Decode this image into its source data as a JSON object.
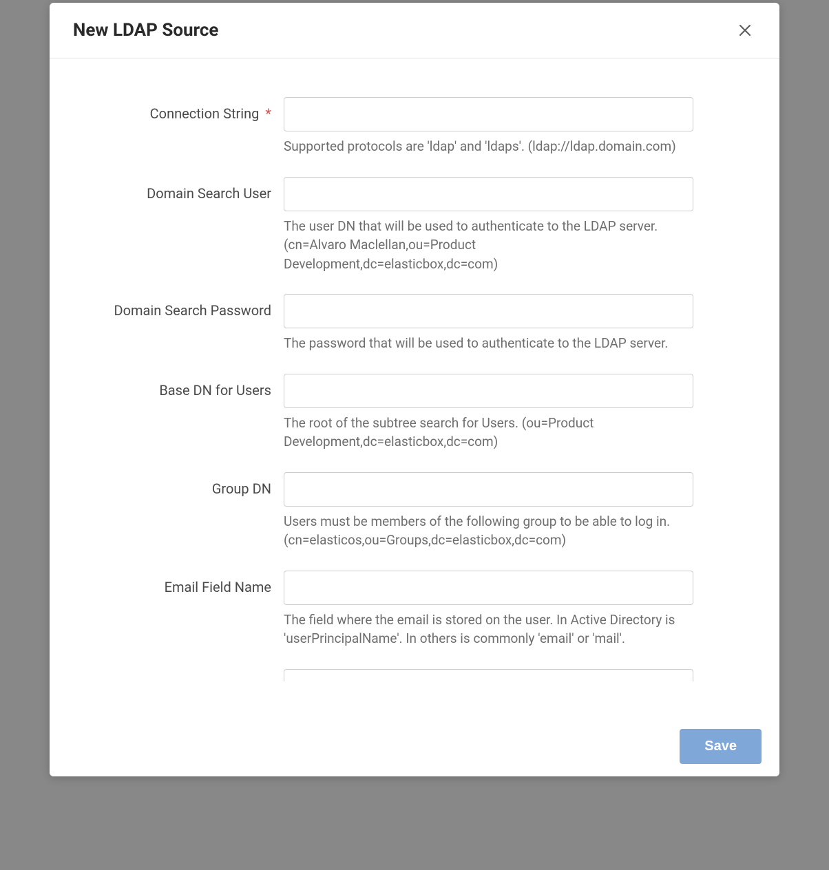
{
  "modal": {
    "title": "New LDAP Source",
    "close_label": "Close"
  },
  "form": {
    "fields": [
      {
        "label": "Connection String",
        "required": true,
        "value": "",
        "help": "Supported protocols are 'ldap' and 'ldaps'. (ldap://ldap.domain.com)"
      },
      {
        "label": "Domain Search User",
        "required": false,
        "value": "",
        "help": "The user DN that will be used to authenticate to the LDAP server. (cn=Alvaro Maclellan,ou=Product Development,dc=elasticbox,dc=com)"
      },
      {
        "label": "Domain Search Password",
        "required": false,
        "value": "",
        "help": "The password that will be used to authenticate to the LDAP server."
      },
      {
        "label": "Base DN for Users",
        "required": false,
        "value": "",
        "help": "The root of the subtree search for Users. (ou=Product Development,dc=elasticbox,dc=com)"
      },
      {
        "label": "Group DN",
        "required": false,
        "value": "",
        "help": "Users must be members of the following group to be able to log in. (cn=elasticos,ou=Groups,dc=elasticbox,dc=com)"
      },
      {
        "label": "Email Field Name",
        "required": false,
        "value": "",
        "help": "The field where the email is stored on the user. In Active Directory is 'userPrincipalName'. In others is commonly 'email' or 'mail'."
      }
    ]
  },
  "footer": {
    "save_label": "Save"
  },
  "required_marker": "*"
}
